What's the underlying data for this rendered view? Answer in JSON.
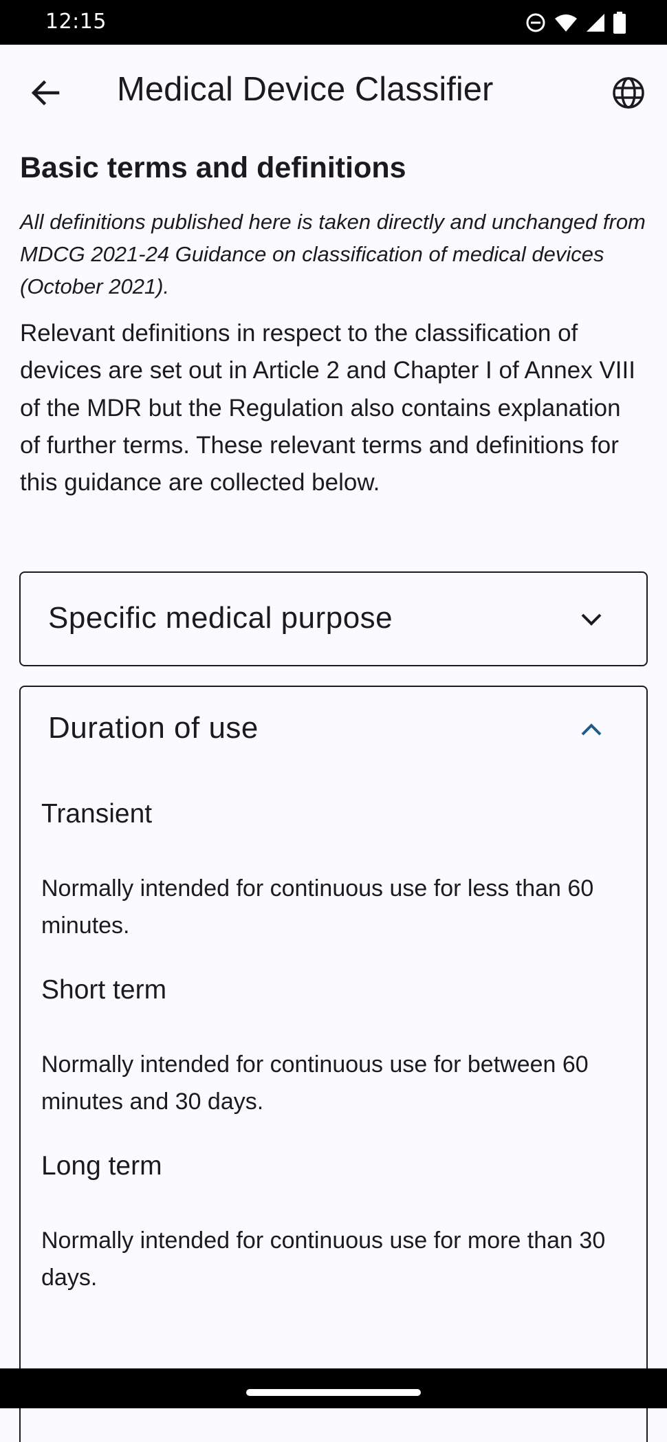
{
  "status_bar": {
    "time": "12:15",
    "icons": [
      "do-not-disturb-icon",
      "wifi-icon",
      "cell-signal-icon",
      "battery-icon"
    ]
  },
  "app_bar": {
    "title": "Medical Device Classifier",
    "back_icon": "arrow-back-icon",
    "language_icon": "globe-icon"
  },
  "content": {
    "heading": "Basic terms and definitions",
    "source_note": "All definitions published here is taken directly and unchanged from MDCG 2021-24 Guidance on classification of medical devices (October 2021).",
    "intro": "Relevant definitions in respect to the classification of devices are set out in Article 2 and Chapter I of Annex VIII of the MDR but the Regulation also contains explanation of further terms. These relevant terms and definitions for this guidance are collected below."
  },
  "accordions": [
    {
      "title": "Specific medical purpose",
      "expanded": false
    },
    {
      "title": "Duration of use",
      "expanded": true,
      "terms": [
        {
          "name": "Transient",
          "definition": "Normally intended for continuous use for less than 60 minutes."
        },
        {
          "name": "Short term",
          "definition": "Normally intended for continuous use for between 60 minutes and 30 days."
        },
        {
          "name": "Long term",
          "definition": "Normally intended for continuous use for more than 30 days."
        }
      ]
    }
  ],
  "colors": {
    "background": "#fbfbff",
    "text": "#1b1b1f",
    "accent": "#1d5b8c",
    "system_bar": "#000000"
  }
}
